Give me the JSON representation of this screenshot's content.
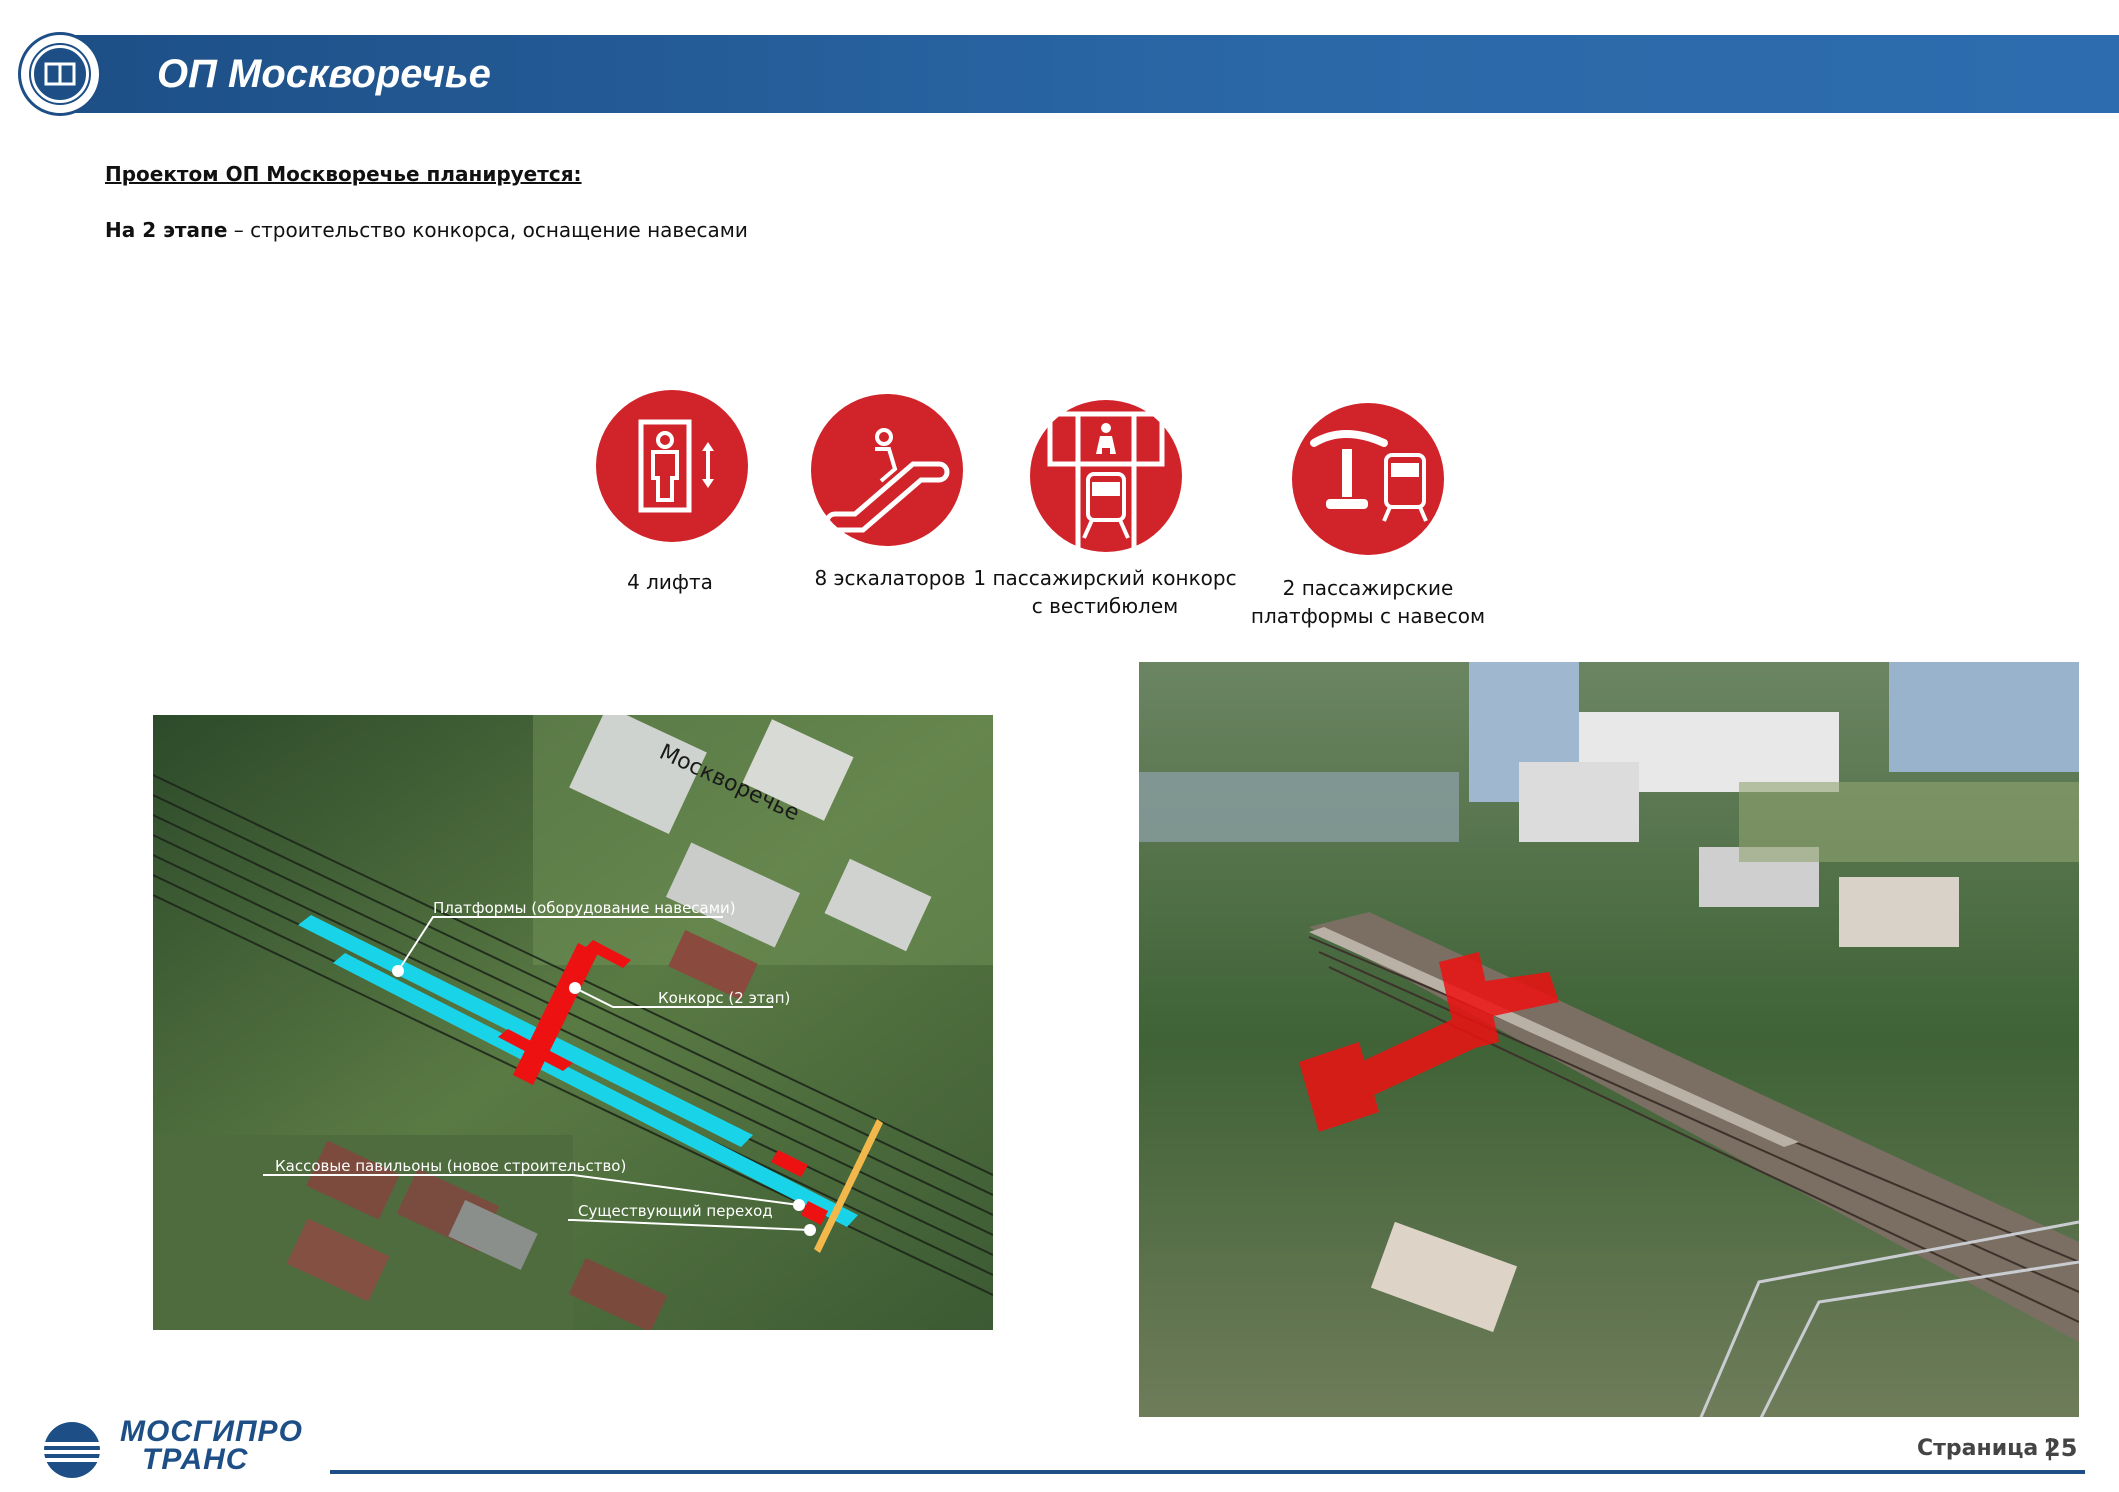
{
  "header": {
    "title": "ОП Москворечье"
  },
  "intro": {
    "heading": "Проектом ОП Москворечье планируется:"
  },
  "stage": {
    "bold": "На 2 этапе",
    "text": " – строительство конкорса, оснащение навесами"
  },
  "features": [
    {
      "icon": "elevator-icon",
      "caption": "4 лифта"
    },
    {
      "icon": "escalator-icon",
      "caption": "8 эскалаторов"
    },
    {
      "icon": "concourse-icon",
      "caption_line1": "1 пассажирский конкорс",
      "caption_line2": "с вестибюлем"
    },
    {
      "icon": "platform-canopy-icon",
      "caption_line1": "2 пассажирские",
      "caption_line2": "платформы с навесом"
    }
  ],
  "map": {
    "place_label": "Москворечье",
    "labels": {
      "platforms": "Платформы (оборудование навесами)",
      "concourse": "Конкорс (2 этап)",
      "ticket": "Кассовые павильоны (новое строительство)",
      "existing": "Существующий переход"
    }
  },
  "footer": {
    "page_label": "Страница",
    "page_number": "25",
    "brand_line1": "МОСГИПРО",
    "brand_line2": "ТРАНС"
  },
  "colors": {
    "brand_blue": "#1d4f86",
    "icon_red": "#d1232a",
    "platform_cyan": "#19d4e8",
    "concourse_red": "#ee1111",
    "passage_yellow": "#f2b84b"
  }
}
